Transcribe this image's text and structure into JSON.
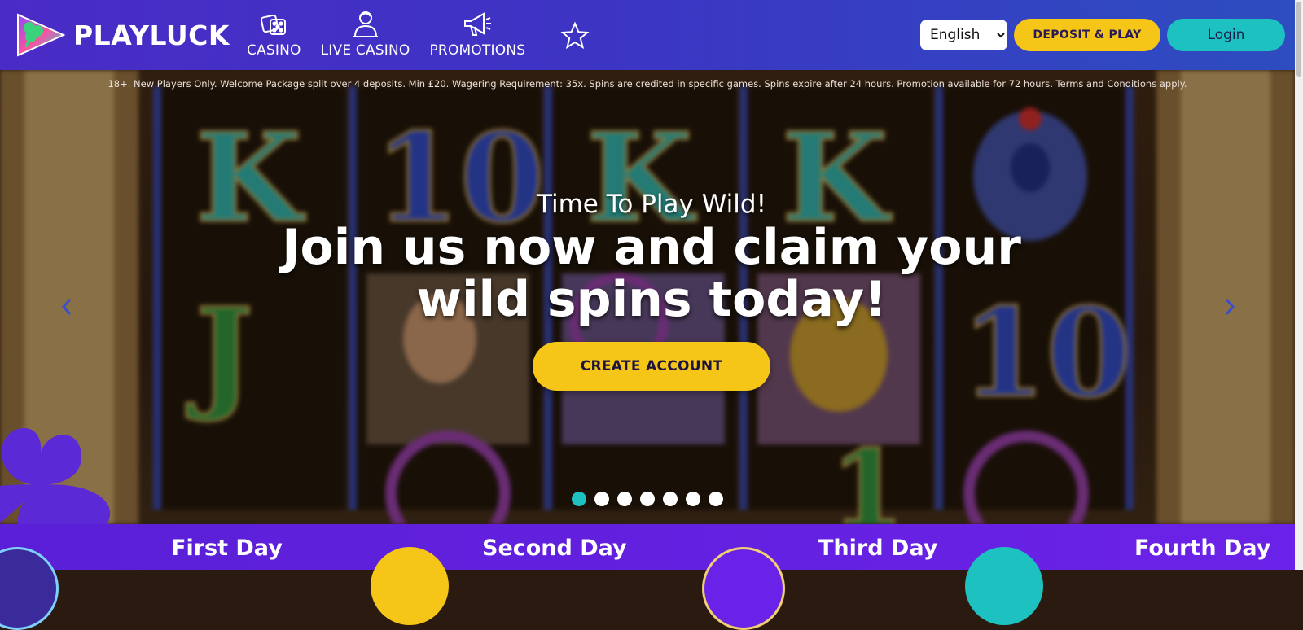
{
  "brand": {
    "name": "PLAYLUCK"
  },
  "nav": {
    "items": [
      {
        "label": "CASINO",
        "icon": "dice-icon"
      },
      {
        "label": "LIVE CASINO",
        "icon": "dealer-icon"
      },
      {
        "label": "PROMOTIONS",
        "icon": "megaphone-icon"
      }
    ],
    "favorites_icon": "star-icon"
  },
  "header": {
    "language": {
      "selected": "English",
      "options": [
        "English"
      ]
    },
    "deposit_label": "DEPOSIT & PLAY",
    "login_label": "Login"
  },
  "hero": {
    "disclaimer": "18+. New Players Only. Welcome Package split over 4 deposits. Min £20. Wagering Requirement: 35x. Spins are credited in specific games. Spins expire after 24 hours. Promotion available for 72 hours. Terms and Conditions apply.",
    "subtitle": "Time To Play Wild!",
    "title": "Join us now and claim your wild spins today!",
    "cta_label": "CREATE ACCOUNT",
    "slides": {
      "count": 7,
      "active": 1
    }
  },
  "welcome_days": [
    {
      "label": "First Day"
    },
    {
      "label": "Second Day"
    },
    {
      "label": "Third Day"
    },
    {
      "label": "Fourth Day"
    }
  ],
  "colors": {
    "header_start": "#4a2bc6",
    "header_end": "#2d4dc0",
    "cta_yellow": "#f5c518",
    "login_teal": "#1dc2c0",
    "bottom_purple": "#5a1fd6",
    "clover_purple": "#5b2ad6"
  }
}
